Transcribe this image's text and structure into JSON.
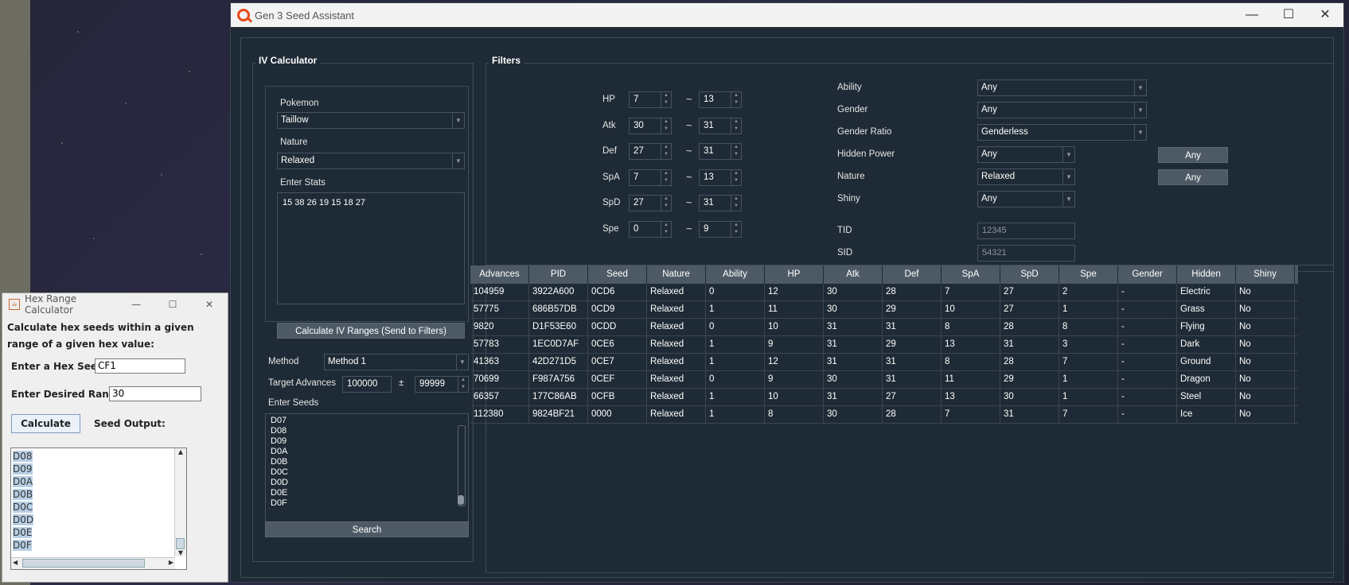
{
  "window": {
    "title": "Gen 3 Seed Assistant",
    "minimize": "—",
    "maximize": "☐",
    "close": "✕"
  },
  "iv_calculator": {
    "title": "IV Calculator",
    "pokemon_label": "Pokemon",
    "pokemon_value": "Taillow",
    "nature_label": "Nature",
    "nature_value": "Relaxed",
    "stats_label": "Enter Stats",
    "stats_value": "15 38 26 19 15 18 27",
    "calc_button": "Calculate IV Ranges (Send to Filters)",
    "method_label": "Method",
    "method_value": "Method 1",
    "target_label": "Target Advances",
    "target_value": "100000",
    "plusminus": "±",
    "range_value": "99999",
    "seeds_label": "Enter Seeds",
    "seeds": [
      "D07",
      "D08",
      "D09",
      "D0A",
      "D0B",
      "D0C",
      "D0D",
      "D0E",
      "D0F"
    ],
    "search_button": "Search"
  },
  "filters": {
    "title": "Filters",
    "tilde": "~",
    "ivs": [
      {
        "stat": "HP",
        "min": "7",
        "max": "13"
      },
      {
        "stat": "Atk",
        "min": "30",
        "max": "31"
      },
      {
        "stat": "Def",
        "min": "27",
        "max": "31"
      },
      {
        "stat": "SpA",
        "min": "7",
        "max": "13"
      },
      {
        "stat": "SpD",
        "min": "27",
        "max": "31"
      },
      {
        "stat": "Spe",
        "min": "0",
        "max": "9"
      }
    ],
    "ability_label": "Ability",
    "ability_value": "Any",
    "gender_label": "Gender",
    "gender_value": "Any",
    "ratio_label": "Gender Ratio",
    "ratio_value": "Genderless",
    "hp_label": "Hidden Power",
    "hp_value": "Any",
    "hp_button": "Any",
    "nature_label": "Nature",
    "nature_value": "Relaxed",
    "nature_button": "Any",
    "shiny_label": "Shiny",
    "shiny_value": "Any",
    "tid_label": "TID",
    "tid_placeholder": "12345",
    "sid_label": "SID",
    "sid_placeholder": "54321"
  },
  "results": {
    "columns": [
      "Advances",
      "PID",
      "Seed",
      "Nature",
      "Ability",
      "HP",
      "Atk",
      "Def",
      "SpA",
      "SpD",
      "Spe",
      "Gender",
      "Hidden",
      "Shiny"
    ],
    "rows": [
      [
        "104959",
        "3922A600",
        "0CD6",
        "Relaxed",
        "0",
        "12",
        "30",
        "28",
        "7",
        "27",
        "2",
        "-",
        "Electric",
        "No"
      ],
      [
        "57775",
        "686B57DB",
        "0CD9",
        "Relaxed",
        "1",
        "11",
        "30",
        "29",
        "10",
        "27",
        "1",
        "-",
        "Grass",
        "No"
      ],
      [
        "9820",
        "D1F53E60",
        "0CDD",
        "Relaxed",
        "0",
        "10",
        "31",
        "31",
        "8",
        "28",
        "8",
        "-",
        "Flying",
        "No"
      ],
      [
        "57783",
        "1EC0D7AF",
        "0CE6",
        "Relaxed",
        "1",
        "9",
        "31",
        "29",
        "13",
        "31",
        "3",
        "-",
        "Dark",
        "No"
      ],
      [
        "41363",
        "42D271D5",
        "0CE7",
        "Relaxed",
        "1",
        "12",
        "31",
        "31",
        "8",
        "28",
        "7",
        "-",
        "Ground",
        "No"
      ],
      [
        "70699",
        "F987A756",
        "0CEF",
        "Relaxed",
        "0",
        "9",
        "30",
        "31",
        "11",
        "29",
        "1",
        "-",
        "Dragon",
        "No"
      ],
      [
        "66357",
        "177C86AB",
        "0CFB",
        "Relaxed",
        "1",
        "10",
        "31",
        "27",
        "13",
        "30",
        "1",
        "-",
        "Steel",
        "No"
      ],
      [
        "112380",
        "9824BF21",
        "0000",
        "Relaxed",
        "1",
        "8",
        "30",
        "28",
        "7",
        "31",
        "7",
        "-",
        "Ice",
        "No"
      ]
    ]
  },
  "hex_window": {
    "title": "Hex Range Calculator",
    "desc_line1": "Calculate hex seeds within a given",
    "desc_line2": "range of a given hex value:",
    "seed_label": "Enter a Hex Seed:",
    "seed_value": "CF1",
    "range_label": "Enter Desired Range:",
    "range_value": "30",
    "calc_button": "Calculate",
    "output_label": "Seed Output:",
    "output": [
      "D08",
      "D09",
      "D0A",
      "D0B",
      "D0C",
      "D0D",
      "D0E",
      "D0F"
    ]
  }
}
